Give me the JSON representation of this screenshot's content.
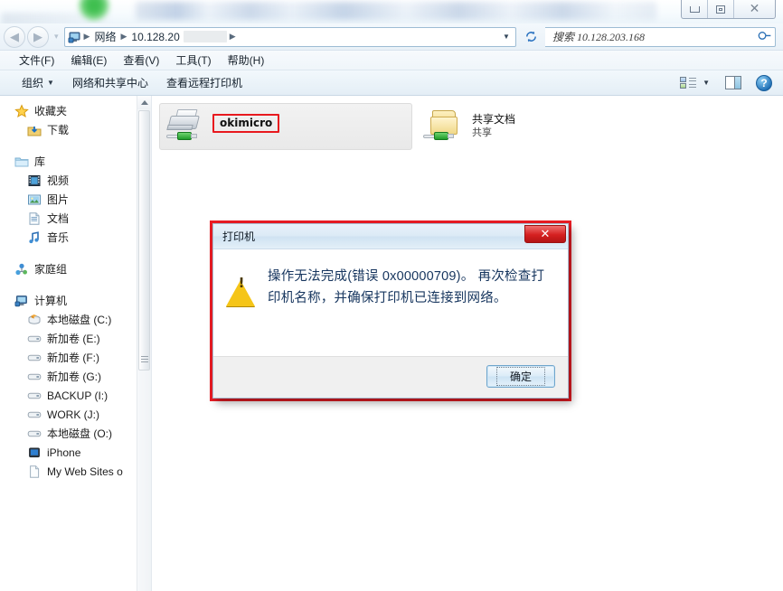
{
  "window": {
    "title_redacted": true,
    "controls": {
      "minimize": "minimize",
      "restore": "restore",
      "close": "close"
    }
  },
  "address_bar": {
    "back_label": "back",
    "forward_label": "forward",
    "crumbs": [
      "网络",
      "10.128.20"
    ],
    "redacted_segment": true,
    "dropdown": "▼",
    "refresh": "refresh",
    "search": {
      "placeholder": "搜索 10.128.203.168",
      "value": ""
    }
  },
  "menu": {
    "items": [
      {
        "label": "文件(F)"
      },
      {
        "label": "编辑(E)"
      },
      {
        "label": "查看(V)"
      },
      {
        "label": "工具(T)"
      },
      {
        "label": "帮助(H)"
      }
    ]
  },
  "toolbar": {
    "organize": "组织",
    "organize_caret": "▼",
    "network_center": "网络和共享中心",
    "view_remote_printers": "查看远程打印机",
    "view_caret": "▼",
    "help_glyph": "?"
  },
  "sidebar": {
    "groups": [
      {
        "header": {
          "label": "收藏夹",
          "icon": "star-icon"
        },
        "items": [
          {
            "label": "下载",
            "icon": "downloads-icon"
          }
        ]
      },
      {
        "header": {
          "label": "库",
          "icon": "library-icon"
        },
        "items": [
          {
            "label": "视频",
            "icon": "video-icon"
          },
          {
            "label": "图片",
            "icon": "pictures-icon"
          },
          {
            "label": "文档",
            "icon": "documents-icon"
          },
          {
            "label": "音乐",
            "icon": "music-icon"
          }
        ]
      },
      {
        "header": {
          "label": "家庭组",
          "icon": "homegroup-icon"
        },
        "items": []
      },
      {
        "header": {
          "label": "计算机",
          "icon": "computer-icon"
        },
        "items": [
          {
            "label": "本地磁盘 (C:)",
            "icon": "system-drive-icon"
          },
          {
            "label": "新加卷 (E:)",
            "icon": "drive-icon"
          },
          {
            "label": "新加卷 (F:)",
            "icon": "drive-icon"
          },
          {
            "label": "新加卷 (G:)",
            "icon": "drive-icon"
          },
          {
            "label": "BACKUP (I:)",
            "icon": "drive-icon"
          },
          {
            "label": "WORK (J:)",
            "icon": "drive-icon"
          },
          {
            "label": "本地磁盘 (O:)",
            "icon": "drive-icon"
          },
          {
            "label": "iPhone",
            "icon": "iphone-icon"
          },
          {
            "label": "My Web Sites o",
            "icon": "page-icon"
          }
        ]
      }
    ]
  },
  "content": {
    "items": [
      {
        "name": "okimicro",
        "sub": "",
        "icon": "network-printer-icon",
        "selected": true,
        "highlighted": true
      },
      {
        "name": "共享文档",
        "sub": "共享",
        "icon": "shared-folder-icon",
        "selected": false,
        "highlighted": false
      }
    ]
  },
  "dialog": {
    "title": "打印机",
    "close_glyph": "✕",
    "icon": "warning-icon",
    "message": "操作无法完成(错误 0x00000709)。 再次检查打印机名称，并确保打印机已连接到网络。",
    "error_code": "0x00000709",
    "ok_button": "确定"
  },
  "annotations": {
    "highlight_color": "#ec1c24",
    "arrow": "red-arrow-pointing-to-printer"
  }
}
